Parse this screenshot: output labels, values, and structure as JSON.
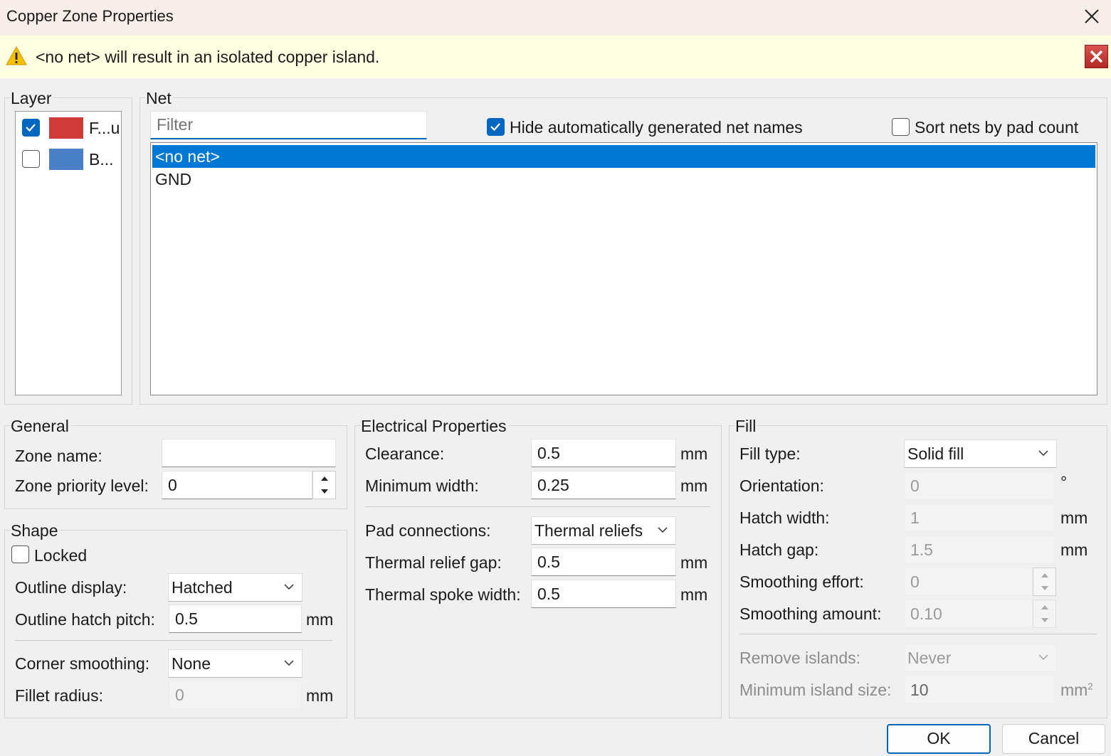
{
  "window": {
    "title": "Copper Zone Properties"
  },
  "infobar": {
    "message": "<no net> will result in an isolated copper island."
  },
  "layer": {
    "group_label": "Layer",
    "items": [
      {
        "label": "F...u",
        "checked": true,
        "color": "#d03a38"
      },
      {
        "label": "B...",
        "checked": false,
        "color": "#4a80c8"
      }
    ]
  },
  "net": {
    "group_label": "Net",
    "filter_placeholder": "Filter",
    "filter_value": "",
    "hide_auto_label": "Hide automatically generated net names",
    "hide_auto_checked": true,
    "sort_by_pad_label": "Sort nets by pad count",
    "sort_by_pad_checked": false,
    "items": [
      {
        "label": "<no net>",
        "selected": true
      },
      {
        "label": "GND",
        "selected": false
      }
    ]
  },
  "general": {
    "group_label": "General",
    "zone_name_label": "Zone name:",
    "zone_name_value": "",
    "priority_label": "Zone priority level:",
    "priority_value": "0"
  },
  "shape": {
    "group_label": "Shape",
    "locked_label": "Locked",
    "locked_checked": false,
    "outline_display_label": "Outline display:",
    "outline_display_value": "Hatched",
    "hatch_pitch_label": "Outline hatch pitch:",
    "hatch_pitch_value": "0.5",
    "hatch_pitch_unit": "mm",
    "corner_smoothing_label": "Corner smoothing:",
    "corner_smoothing_value": "None",
    "fillet_radius_label": "Fillet radius:",
    "fillet_radius_value": "0",
    "fillet_radius_unit": "mm"
  },
  "electrical": {
    "group_label": "Electrical Properties",
    "clearance_label": "Clearance:",
    "clearance_value": "0.5",
    "clearance_unit": "mm",
    "min_width_label": "Minimum width:",
    "min_width_value": "0.25",
    "min_width_unit": "mm",
    "pad_conn_label": "Pad connections:",
    "pad_conn_value": "Thermal reliefs",
    "relief_gap_label": "Thermal relief gap:",
    "relief_gap_value": "0.5",
    "relief_gap_unit": "mm",
    "spoke_width_label": "Thermal spoke width:",
    "spoke_width_value": "0.5",
    "spoke_width_unit": "mm"
  },
  "fill": {
    "group_label": "Fill",
    "fill_type_label": "Fill type:",
    "fill_type_value": "Solid fill",
    "orientation_label": "Orientation:",
    "orientation_value": "0",
    "orientation_unit": "°",
    "hatch_width_label": "Hatch width:",
    "hatch_width_value": "1",
    "hatch_width_unit": "mm",
    "hatch_gap_label": "Hatch gap:",
    "hatch_gap_value": "1.5",
    "hatch_gap_unit": "mm",
    "smoothing_effort_label": "Smoothing effort:",
    "smoothing_effort_value": "0",
    "smoothing_amount_label": "Smoothing amount:",
    "smoothing_amount_value": "0.10",
    "remove_islands_label": "Remove islands:",
    "remove_islands_value": "Never",
    "min_island_label": "Minimum island size:",
    "min_island_value": "10",
    "min_island_unit": "mm",
    "min_island_unit_sup": "2"
  },
  "buttons": {
    "ok": "OK",
    "cancel": "Cancel"
  }
}
